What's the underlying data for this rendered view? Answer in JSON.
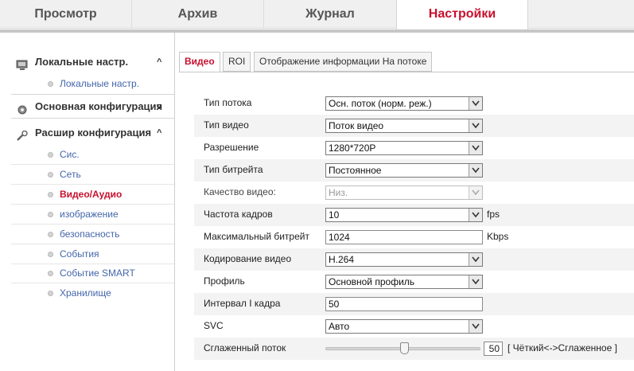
{
  "topnav": {
    "tabs": [
      "Просмотр",
      "Архив",
      "Журнал",
      "Настройки"
    ],
    "active_index": 3
  },
  "sidebar": {
    "sections": [
      {
        "label": "Локальные настр.",
        "chevron": "^",
        "icon": "monitor-icon",
        "items": [
          "Локальные настр."
        ]
      },
      {
        "label": "Основная конфигурация",
        "chevron": "v",
        "icon": "gear-icon",
        "items": []
      },
      {
        "label": "Расшир конфигурация",
        "chevron": "^",
        "icon": "wrench-icon",
        "items": [
          "Сис.",
          "Сеть",
          "Видео/Аудио",
          "изображение",
          "безопасность",
          "События",
          "Событие SMART",
          "Хранилище"
        ]
      }
    ],
    "active_item": "Видео/Аудио"
  },
  "content_tabs": {
    "tabs": [
      "Видео",
      "ROI",
      "Отображение информации На потоке"
    ],
    "active_index": 0
  },
  "form": {
    "stream_type": {
      "label": "Тип потока",
      "value": "Осн. поток (норм. реж.)"
    },
    "video_type": {
      "label": "Тип видео",
      "value": "Поток видео"
    },
    "resolution": {
      "label": "Разрешение",
      "value": "1280*720P"
    },
    "bitrate_type": {
      "label": "Тип битрейта",
      "value": "Постоянное"
    },
    "video_quality": {
      "label": "Качество видео:",
      "value": "Низ.",
      "disabled": true
    },
    "frame_rate": {
      "label": "Частота кадров",
      "value": "10",
      "unit": "fps"
    },
    "max_bitrate": {
      "label": "Максимальный битрейт",
      "value": "1024",
      "unit": "Kbps"
    },
    "video_encoding": {
      "label": "Кодирование видео",
      "value": "H.264"
    },
    "profile": {
      "label": "Профиль",
      "value": "Основной профиль"
    },
    "i_frame_interval": {
      "label": "Интервал I кадра",
      "value": "50"
    },
    "svc": {
      "label": "SVC",
      "value": "Авто"
    },
    "smoothing": {
      "label": "Сглаженный поток",
      "value": "50",
      "level_fraction": 0.5,
      "hint": "[ Чёткий<->Сглаженное ]"
    }
  },
  "colors": {
    "accent": "#c8102e",
    "link": "#4466aa"
  }
}
